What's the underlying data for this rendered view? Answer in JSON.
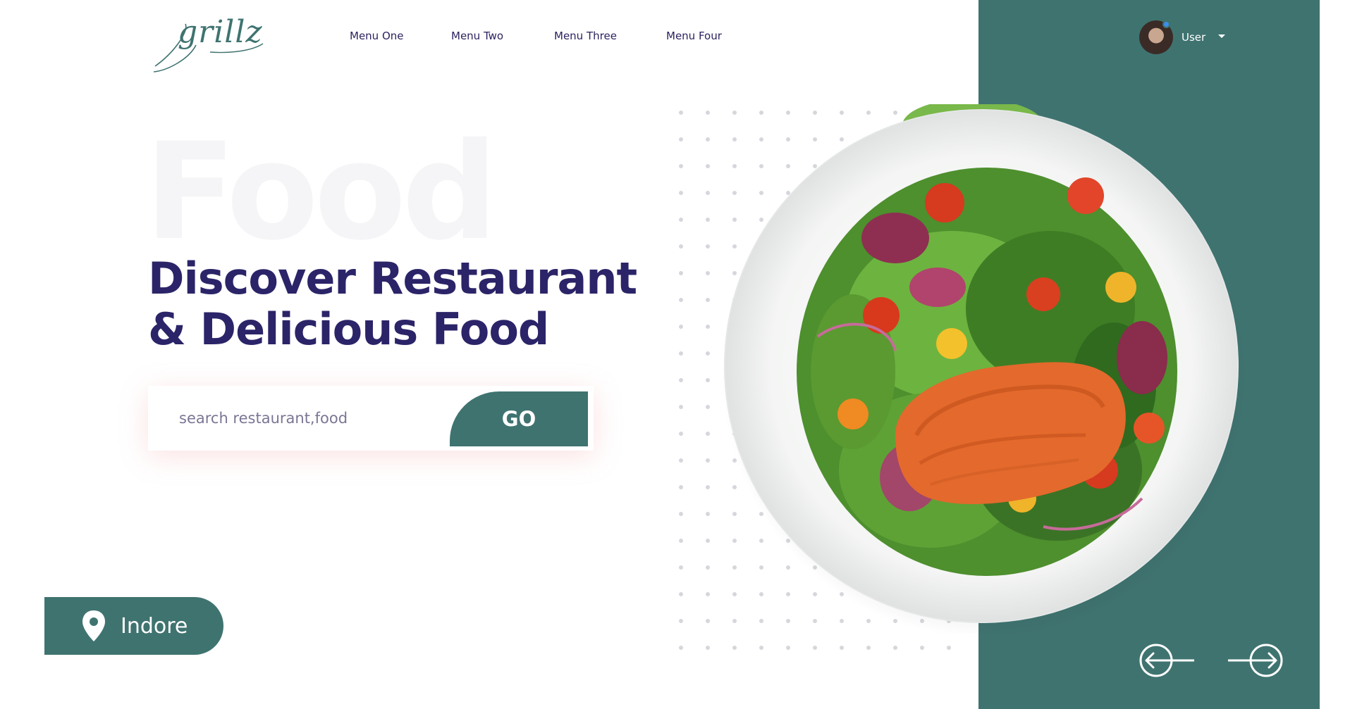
{
  "brand": {
    "logo_text": "grillz"
  },
  "nav": {
    "items": [
      {
        "label": "Menu One"
      },
      {
        "label": "Menu Two"
      },
      {
        "label": "Menu Three"
      },
      {
        "label": "Menu Four"
      }
    ]
  },
  "user": {
    "label": "User",
    "avatar_icon": "user-avatar",
    "status_color": "#3d8dee"
  },
  "hero": {
    "background_word": "Food",
    "headline_line1": "Discover Restaurant",
    "headline_line2": "& Delicious Food"
  },
  "search": {
    "placeholder": "search restaurant,food",
    "value": "",
    "button_label": "GO"
  },
  "location": {
    "label": "Indore",
    "icon": "map-pin-icon"
  },
  "carousel": {
    "prev_icon": "arrow-left-circle-icon",
    "next_icon": "arrow-right-circle-icon"
  },
  "colors": {
    "accent": "#3f7370",
    "heading": "#2b2468",
    "background_word": "#f5f5f7"
  }
}
